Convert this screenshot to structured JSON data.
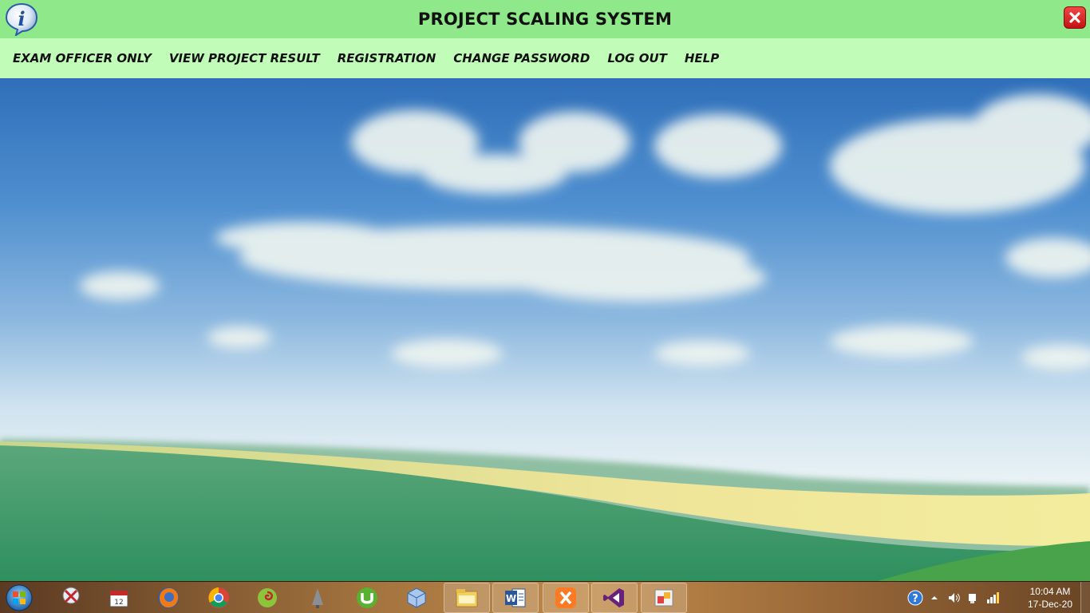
{
  "window": {
    "title": "PROJECT SCALING SYSTEM",
    "info_icon": "info-icon",
    "close_icon": "close-icon"
  },
  "menu": {
    "items": [
      {
        "label": "EXAM OFFICER ONLY"
      },
      {
        "label": "VIEW PROJECT RESULT"
      },
      {
        "label": "REGISTRATION"
      },
      {
        "label": "CHANGE PASSWORD"
      },
      {
        "label": "LOG OUT"
      },
      {
        "label": "HELP"
      }
    ]
  },
  "colors": {
    "titlebar": "#8fe98a",
    "menubar": "#c1fdb8",
    "close": "#d92323"
  },
  "taskbar": {
    "start_icon": "windows-start-icon",
    "items": [
      {
        "icon": "snipping-tool-icon"
      },
      {
        "icon": "calendar-app-icon"
      },
      {
        "icon": "firefox-icon"
      },
      {
        "icon": "chrome-icon"
      },
      {
        "icon": "chameleon-app-icon"
      },
      {
        "icon": "pine-app-icon"
      },
      {
        "icon": "utorrent-icon"
      },
      {
        "icon": "virtualbox-cube-icon"
      },
      {
        "icon": "file-explorer-icon"
      },
      {
        "icon": "word-icon"
      },
      {
        "icon": "xampp-icon"
      },
      {
        "icon": "visual-studio-icon"
      },
      {
        "icon": "app-window-icon"
      }
    ],
    "tray": {
      "icons": [
        "help-icon",
        "show-hidden-icons-icon",
        "volume-icon",
        "network-icon",
        "power-icon"
      ],
      "time": "10:04 AM",
      "date": "17-Dec-20"
    }
  }
}
